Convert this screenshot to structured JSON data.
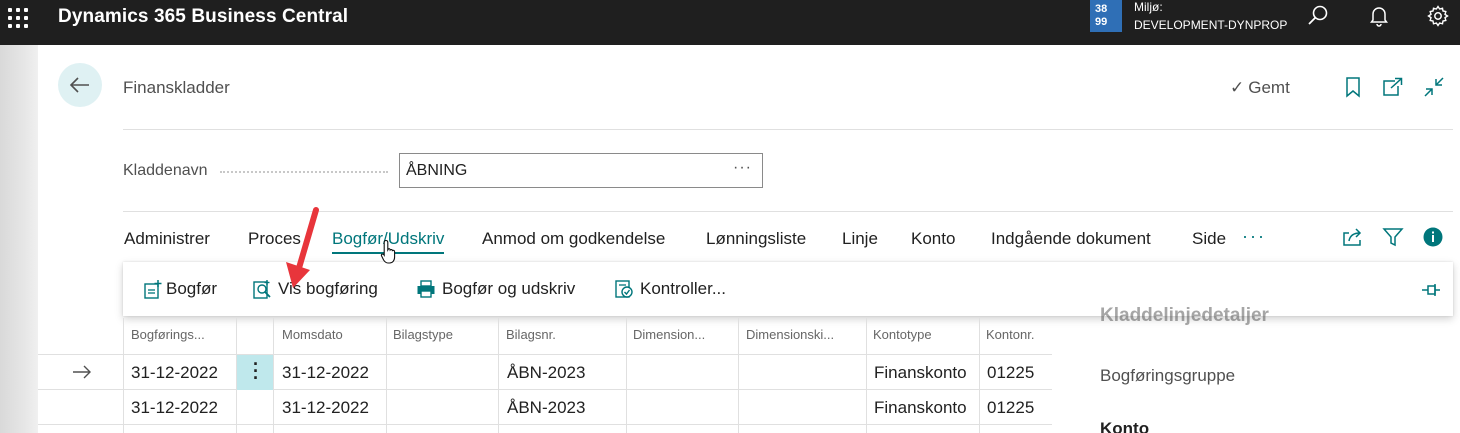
{
  "appbar": {
    "title": "Dynamics 365 Business Central",
    "env_badge_top": "38",
    "env_badge_bottom": "99",
    "env_label": "Miljø:",
    "env_value": "DEVELOPMENT-DYNPROP",
    "icons": [
      "waffle-icon",
      "search-icon",
      "bell-icon",
      "gear-icon"
    ]
  },
  "page": {
    "title": "Finanskladder",
    "saved_label": "Gemt",
    "header_icons": [
      "bookmark-icon",
      "open-new-window-icon",
      "collapse-icon"
    ]
  },
  "field": {
    "label": "Kladdenavn",
    "value": "ÅBNING",
    "more": "···"
  },
  "actions": {
    "items": [
      "Administrer",
      "Proces",
      "Bogfør/Udskriv",
      "Anmod om godkendelse",
      "Lønningsliste",
      "Linje",
      "Konto",
      "Indgående dokument",
      "Side"
    ],
    "active_index": 2,
    "more": "···",
    "icons": [
      "share-icon",
      "filter-icon",
      "info-icon"
    ]
  },
  "submenu": {
    "items": [
      {
        "label": "Bogfør",
        "icon": "post-icon"
      },
      {
        "label": "Vis bogføring",
        "icon": "preview-posting-icon"
      },
      {
        "label": "Bogfør og udskriv",
        "icon": "print-icon"
      },
      {
        "label": "Kontroller...",
        "icon": "check-icon"
      }
    ],
    "pin_icon": "pin-icon"
  },
  "table": {
    "columns": [
      "Bogførings...",
      "Momsdato",
      "Bilagstype",
      "Bilagsnr.",
      "Dimension...",
      "Dimensionski...",
      "Kontotype",
      "Kontonr."
    ],
    "rows": [
      {
        "bogforingsdato": "31-12-2022",
        "momsdato": "31-12-2022",
        "bilagstype": "",
        "bilagsnr": "ÅBN-2023",
        "dim1": "",
        "dim2": "",
        "kontotype": "Finanskonto",
        "kontonr": "01225"
      },
      {
        "bogforingsdato": "31-12-2022",
        "momsdato": "31-12-2022",
        "bilagstype": "",
        "bilagsnr": "ÅBN-2023",
        "dim1": "",
        "dim2": "",
        "kontotype": "Finanskonto",
        "kontonr": "01225"
      }
    ]
  },
  "factbox": {
    "title": "Kladdelinjedetaljer",
    "item1": "Bogføringsgruppe",
    "item2": "Konto"
  },
  "colors": {
    "appbar_bg": "#1f1f1f",
    "accent": "#00767b",
    "env_badge": "#2f6fb6",
    "annotation": "#e8353b"
  }
}
